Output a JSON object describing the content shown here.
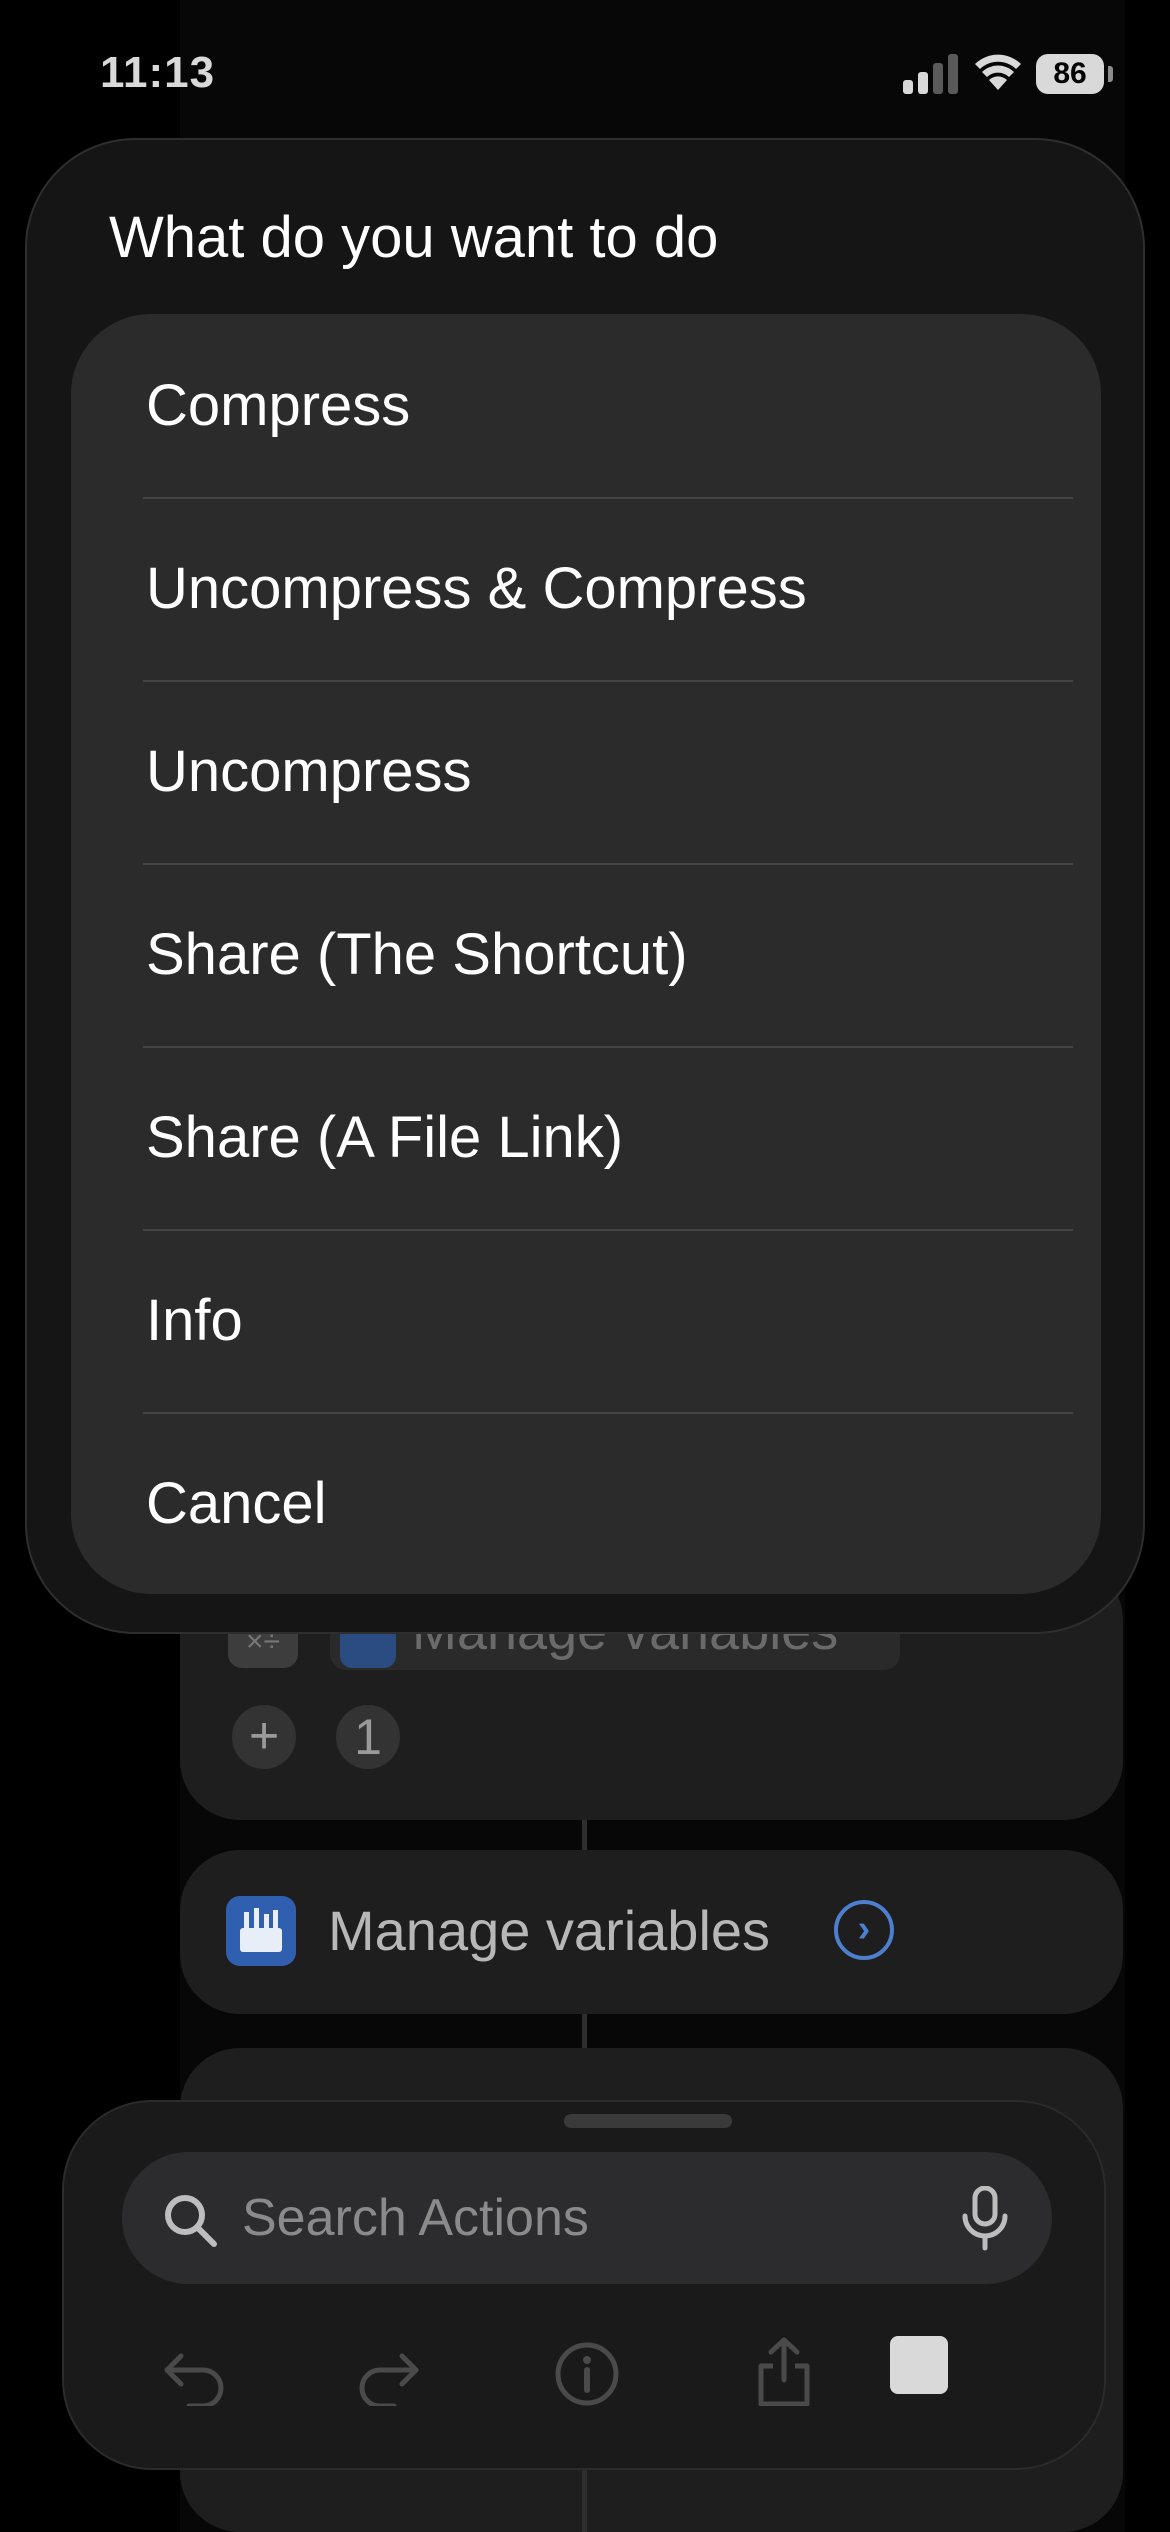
{
  "status_bar": {
    "time": "11:13",
    "battery_level": "86"
  },
  "action_sheet": {
    "title": "What do you want to do",
    "options": [
      {
        "label": "Compress"
      },
      {
        "label": "Uncompress & Compress"
      },
      {
        "label": "Uncompress"
      },
      {
        "label": "Share (The Shortcut)"
      },
      {
        "label": "Share (A File Link)"
      },
      {
        "label": "Info"
      },
      {
        "label": "Cancel"
      }
    ]
  },
  "editor": {
    "partial_action_label": "Manage variables",
    "partial_action_icon": "calculator-icon",
    "parameter_value": "1",
    "add_parameter_symbol": "+",
    "manage_action": {
      "label": "Manage variables",
      "icon": "toolbox-icon",
      "chevron": "›"
    }
  },
  "search": {
    "placeholder": "Search Actions"
  },
  "toolbar": {
    "buttons": [
      "undo-icon",
      "redo-icon",
      "info-icon",
      "share-icon",
      "stop-icon"
    ]
  }
}
